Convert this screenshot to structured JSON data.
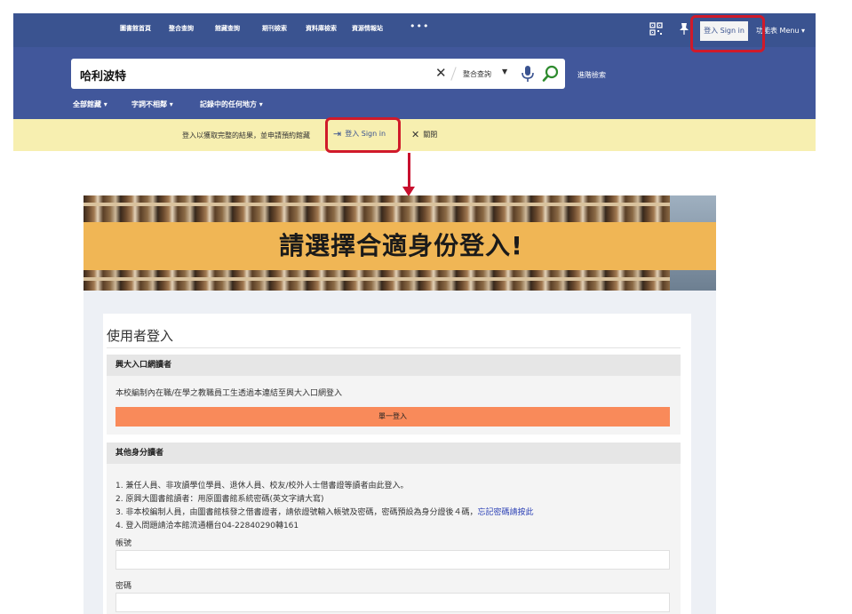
{
  "top": {
    "nav": {
      "items": [
        "圖書館首頁",
        "整合查詢",
        "館藏查詢",
        "期刊檢索",
        "資料庫檢索",
        "資源情報站"
      ],
      "more": "•••",
      "signin_label": "登入 Sign in",
      "menu_label": "功能表 Menu"
    },
    "search": {
      "query": "哈利波特",
      "clear": "✕",
      "scope_label": "整合查詢",
      "scope_caret": "▼",
      "advanced_label": "進階檢索"
    },
    "filters": [
      "全部館藏 ▾",
      "字詞不相鄰 ▾",
      "記錄中的任何地方 ▾"
    ],
    "notice": {
      "text": "登入以獲取完整的結果，並申請預約館藏",
      "signin_label": "登入 Sign in",
      "close_label": "關閉"
    }
  },
  "banner": {
    "title": "請選擇合適身份登入!"
  },
  "login": {
    "title": "使用者登入",
    "portal": {
      "header": "興大入口網讀者",
      "description": "本校編制內在職/在學之教職員工生透過本連結至興大入口網登入",
      "sso_label": "單一登入"
    },
    "other": {
      "header": "其他身分讀者",
      "rules": [
        "1. 兼任人員、非攻讀學位學員、退休人員、校友/校外人士借書證等讀者由此登入。",
        "2. 原興大圖書館讀者：用原圖書館系統密碼(英文字請大寫)",
        "3. 非本校編制人員，由圖書館核發之借書證者，請依證號輸入帳號及密碼，密碼預設為身分證後４碼，",
        "4. 登入問題請洽本館流通櫃台04-22840290轉161"
      ],
      "forgot_link": "忘記密碼請按此",
      "account_label": "帳號",
      "password_label": "密碼",
      "account_value": "",
      "password_value": ""
    }
  },
  "colors": {
    "nav": "#3a5390",
    "search_band": "#41579b",
    "notice": "#f7efb0",
    "highlight": "#d01a2a",
    "banner_strip": "#f0b655",
    "sso_button": "#f98a5a"
  }
}
